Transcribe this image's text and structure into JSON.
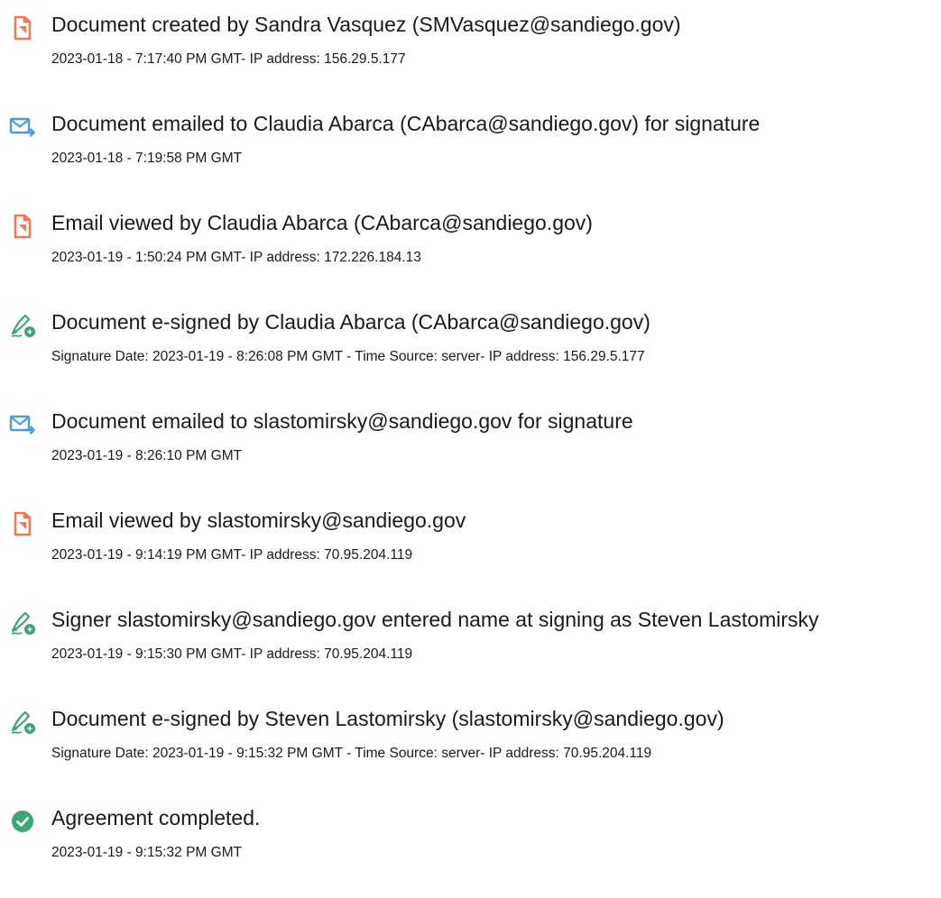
{
  "colors": {
    "document_icon": "#EE7A52",
    "email_icon": "#4A9FE0",
    "esign_icon": "#3FA27C",
    "complete_icon": "#3DA677"
  },
  "events": [
    {
      "icon": "document-icon",
      "title": "Document created by Sandra Vasquez (SMVasquez@sandiego.gov)",
      "detail": "2023-01-18 - 7:17:40 PM GMT- IP address: 156.29.5.177"
    },
    {
      "icon": "email-send-icon",
      "title": "Document emailed to Claudia Abarca (CAbarca@sandiego.gov) for signature",
      "detail": "2023-01-18 - 7:19:58 PM GMT"
    },
    {
      "icon": "document-icon",
      "title": "Email viewed by Claudia Abarca (CAbarca@sandiego.gov)",
      "detail": "2023-01-19 - 1:50:24 PM GMT- IP address: 172.226.184.13"
    },
    {
      "icon": "esign-pen-icon",
      "title": "Document e-signed by Claudia Abarca (CAbarca@sandiego.gov)",
      "detail": "Signature Date: 2023-01-19 - 8:26:08 PM GMT - Time Source: server- IP address: 156.29.5.177"
    },
    {
      "icon": "email-send-icon",
      "title": "Document emailed to slastomirsky@sandiego.gov for signature",
      "detail": "2023-01-19 - 8:26:10 PM GMT"
    },
    {
      "icon": "document-icon",
      "title": "Email viewed by slastomirsky@sandiego.gov",
      "detail": "2023-01-19 - 9:14:19 PM GMT- IP address: 70.95.204.119"
    },
    {
      "icon": "esign-pen-icon",
      "title": "Signer slastomirsky@sandiego.gov entered name at signing as Steven Lastomirsky",
      "detail": "2023-01-19 - 9:15:30 PM GMT- IP address: 70.95.204.119"
    },
    {
      "icon": "esign-pen-icon",
      "title": "Document e-signed by Steven Lastomirsky (slastomirsky@sandiego.gov)",
      "detail": "Signature Date: 2023-01-19 - 9:15:32 PM GMT - Time Source: server- IP address: 70.95.204.119"
    },
    {
      "icon": "checkmark-circle-icon",
      "title": "Agreement completed.",
      "detail": "2023-01-19 - 9:15:32 PM GMT"
    }
  ]
}
